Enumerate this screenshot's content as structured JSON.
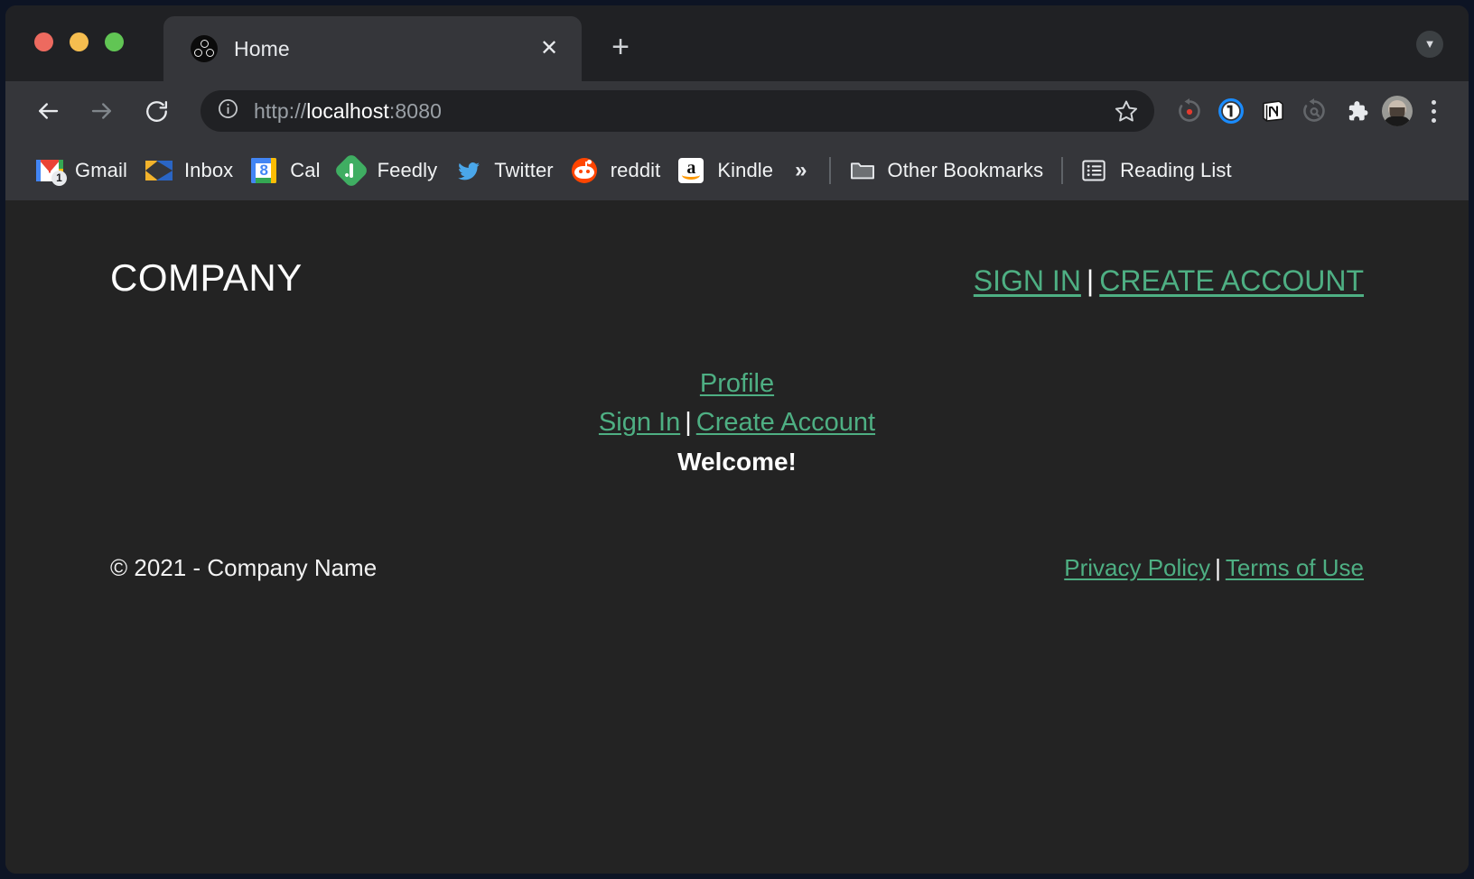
{
  "browser": {
    "tab": {
      "title": "Home",
      "favicon": "molecule-icon",
      "close_label": "✕"
    },
    "new_tab_label": "+",
    "tabstrip_caret": "▼",
    "toolbar": {
      "back_icon": "back-arrow-icon",
      "forward_icon": "forward-arrow-icon",
      "reload_icon": "reload-icon",
      "site_info_icon": "info-circle-icon",
      "url_scheme": "http://",
      "url_host": "localhost",
      "url_port": ":8080",
      "url_full": "http://localhost:8080",
      "bookmark_star_icon": "star-icon",
      "extensions": [
        {
          "name": "rescue-time-icon",
          "label": "RescueTime"
        },
        {
          "name": "1password-icon",
          "label": "1Password"
        },
        {
          "name": "notion-icon",
          "label": "Notion Web Clipper"
        },
        {
          "name": "session-buddy-icon",
          "label": "Session Buddy"
        },
        {
          "name": "puzzle-icon",
          "label": "Extensions"
        }
      ],
      "profile_label": "Profile avatar",
      "menu_label": "Customize and control Google Chrome"
    },
    "bookmarks": {
      "items": [
        {
          "label": "Gmail",
          "icon": "gmail-icon",
          "badge": "1"
        },
        {
          "label": "Inbox",
          "icon": "inbox-icon",
          "badge": ""
        },
        {
          "label": "Cal",
          "icon": "google-calendar-icon",
          "badge": "8"
        },
        {
          "label": "Feedly",
          "icon": "feedly-icon",
          "badge": ""
        },
        {
          "label": "Twitter",
          "icon": "twitter-icon",
          "badge": ""
        },
        {
          "label": "reddit",
          "icon": "reddit-icon",
          "badge": ""
        },
        {
          "label": "Kindle",
          "icon": "amazon-kindle-icon",
          "badge": ""
        }
      ],
      "overflow_label": "»",
      "other_bookmarks": {
        "label": "Other Bookmarks",
        "icon": "folder-icon"
      },
      "reading_list": {
        "label": "Reading List",
        "icon": "reading-list-icon"
      }
    }
  },
  "page": {
    "brand": "COMPANY",
    "header_nav": {
      "sign_in": "SIGN IN",
      "separator": "|",
      "create_account": "CREATE ACCOUNT"
    },
    "main": {
      "profile_link": "Profile",
      "sign_in_link": "Sign In",
      "separator": "|",
      "create_account_link": "Create Account",
      "welcome_heading": "Welcome!"
    },
    "footer": {
      "copyright": "© 2021 - Company Name",
      "privacy_policy": "Privacy Policy",
      "separator": "|",
      "terms_of_use": "Terms of Use"
    },
    "colors": {
      "background": "#232323",
      "link_green": "#4eaf83",
      "text_white": "#ffffff"
    }
  }
}
